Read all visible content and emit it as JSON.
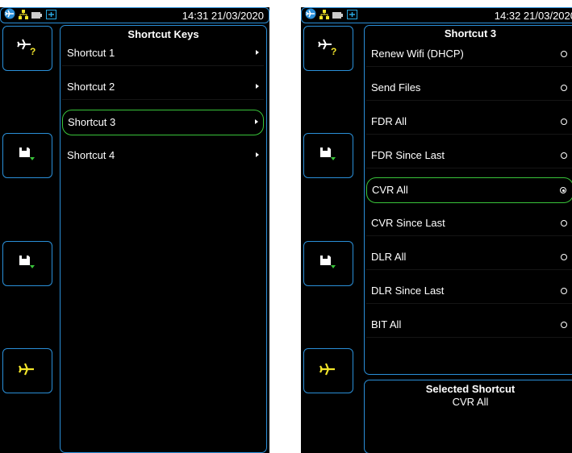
{
  "colors": {
    "accent": "#2a8fd8",
    "selection": "#39c43a",
    "highlight": "#f2e52a",
    "background": "#000000"
  },
  "left_screen": {
    "status_time": "14:31 21/03/2020",
    "status_icons": [
      "airplane-icon",
      "network-icon",
      "battery-icon",
      "card-icon"
    ],
    "side_buttons": [
      "airplane-help-icon",
      "floppy-download-icon",
      "floppy-download-icon",
      "airplane-icon"
    ],
    "title": "Shortcut Keys",
    "items": [
      {
        "label": "Shortcut 1"
      },
      {
        "label": "Shortcut 2"
      },
      {
        "label": "Shortcut 3",
        "selected": true
      },
      {
        "label": "Shortcut 4"
      }
    ]
  },
  "right_screen": {
    "status_time": "14:32 21/03/2020",
    "status_icons": [
      "airplane-icon",
      "network-icon",
      "battery-icon",
      "card-icon"
    ],
    "side_buttons": [
      "airplane-help-icon",
      "floppy-download-icon",
      "floppy-download-icon",
      "airplane-icon"
    ],
    "title": "Shortcut 3",
    "items": [
      {
        "label": "Renew Wifi (DHCP)"
      },
      {
        "label": "Send Files"
      },
      {
        "label": "FDR All"
      },
      {
        "label": "FDR Since Last"
      },
      {
        "label": "CVR All",
        "selected": true
      },
      {
        "label": "CVR Since Last"
      },
      {
        "label": "DLR All"
      },
      {
        "label": "DLR Since Last"
      },
      {
        "label": "BIT All"
      }
    ],
    "selected_title": "Selected Shortcut",
    "selected_value": "CVR All"
  }
}
